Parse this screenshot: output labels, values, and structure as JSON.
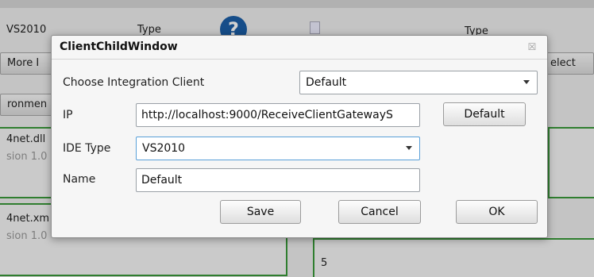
{
  "background": {
    "left_values": [
      "VS2010",
      "More I",
      "ronmen",
      "4net.dll",
      "sion 1.0",
      "4net.xm",
      "sion 1.0"
    ],
    "type_label_left": "Type",
    "type_label_right": "Type",
    "select_label": "elect",
    "right_value": "5",
    "help_glyph": "?"
  },
  "dialog": {
    "title": "ClientChildWindow",
    "close_glyph": "☒",
    "client_label": "Choose Integration Client",
    "client_value": "Default",
    "ip_label": "IP",
    "ip_value": "http://localhost:9000/ReceiveClientGatewayS",
    "ip_default_button": "Default",
    "ide_label": "IDE Type",
    "ide_value": "VS2010",
    "name_label": "Name",
    "name_value": "Default",
    "save_button": "Save",
    "cancel_button": "Cancel",
    "ok_button": "OK"
  },
  "colors": {
    "accent_green": "#3a9a3a",
    "help_blue": "#1b5fa8",
    "focus_blue": "#5aa0d8"
  }
}
